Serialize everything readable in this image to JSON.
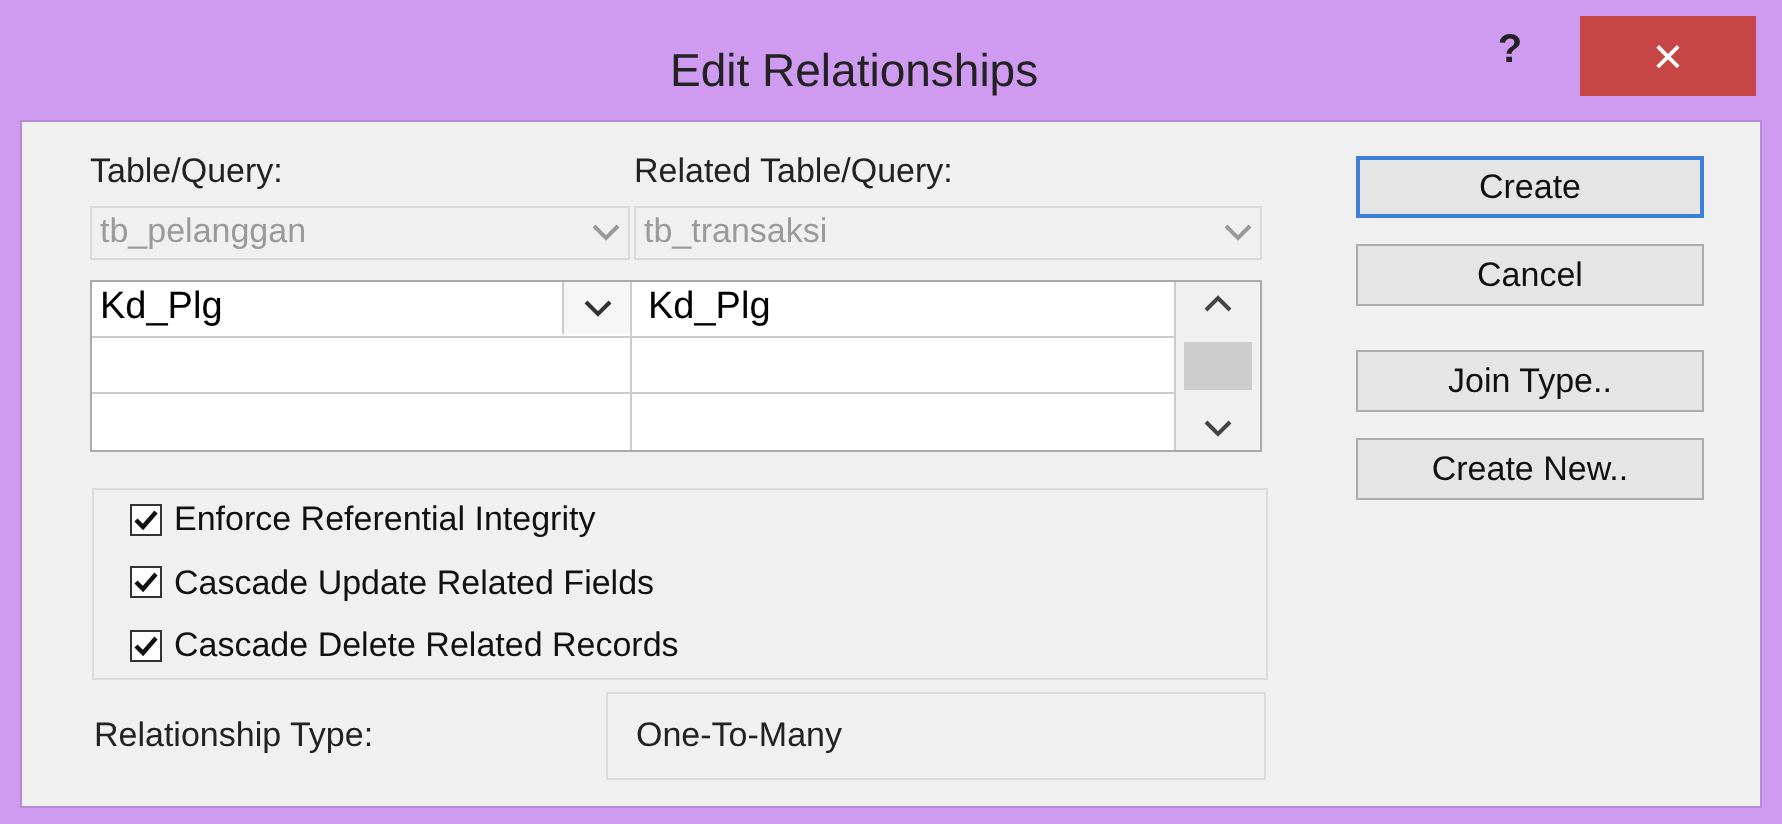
{
  "window": {
    "title": "Edit Relationships",
    "help": "?",
    "close": "×"
  },
  "table_label": "Table/Query:",
  "related_label": "Related Table/Query:",
  "table_select": {
    "value": "tb_pelanggan",
    "disabled": true
  },
  "related_select": {
    "value": "tb_transaksi",
    "disabled": true
  },
  "grid": {
    "rows": [
      {
        "column_1": "Kd_Plg",
        "column_2": "Kd_Plg",
        "selected": true
      },
      {
        "column_1": "",
        "column_2": "",
        "selected": false
      },
      {
        "column_1": "",
        "column_2": "",
        "selected": false
      }
    ]
  },
  "options": [
    {
      "label": "Enforce Referential Integrity",
      "checked": true
    },
    {
      "label": "Cascade Update Related Fields",
      "checked": true
    },
    {
      "label": "Cascade Delete Related Records",
      "checked": true
    }
  ],
  "relationship_type": {
    "label": "Relationship Type:",
    "value": "One-To-Many"
  },
  "buttons": [
    {
      "label": "Create",
      "default": true
    },
    {
      "label": "Cancel",
      "default": false
    },
    {
      "label": "Join Type..",
      "default": false
    },
    {
      "label": "Create New..",
      "default": false
    }
  ]
}
